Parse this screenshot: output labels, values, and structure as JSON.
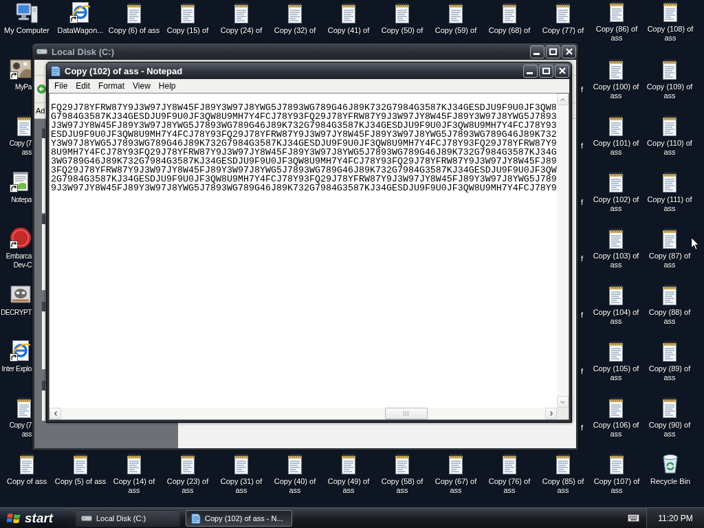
{
  "desktop": {
    "top_row": [
      {
        "label": "My Computer",
        "kind": "computer",
        "shortcut": false
      },
      {
        "label": "DataWagon...",
        "kind": "browser",
        "shortcut": true
      },
      {
        "label": "Copy (6) of ass",
        "kind": "text",
        "shortcut": false
      },
      {
        "label": "Copy (15) of",
        "kind": "text",
        "shortcut": false
      },
      {
        "label": "Copy (24) of",
        "kind": "text",
        "shortcut": false
      },
      {
        "label": "Copy (32) of",
        "kind": "text",
        "shortcut": false
      },
      {
        "label": "Copy (41) of",
        "kind": "text",
        "shortcut": false
      },
      {
        "label": "Copy (50) of",
        "kind": "text",
        "shortcut": false
      },
      {
        "label": "Copy (59) of",
        "kind": "text",
        "shortcut": false
      },
      {
        "label": "Copy (68) of",
        "kind": "text",
        "shortcut": false
      },
      {
        "label": "Copy (77) of",
        "kind": "text",
        "shortcut": false
      },
      {
        "label": "Copy (86) of ass",
        "kind": "text",
        "shortcut": false
      },
      {
        "label": "Copy (108) of ass",
        "kind": "text",
        "shortcut": false
      }
    ],
    "left_column": [
      {
        "label": "MyPa",
        "kind": "photo",
        "shortcut": true
      },
      {
        "label": "Copy (7 ass",
        "kind": "text",
        "shortcut": false
      },
      {
        "label": "Notepa",
        "kind": "editor",
        "shortcut": true
      },
      {
        "label": "Embarca Dev-C",
        "kind": "devcpp",
        "shortcut": true
      },
      {
        "label": "DECRYPT",
        "kind": "decrypt",
        "shortcut": false
      },
      {
        "label": "Inter Explo",
        "kind": "browser",
        "shortcut": true
      },
      {
        "label": "Copy (7 ass",
        "kind": "text",
        "shortcut": false
      }
    ],
    "cut_labels": [
      "f",
      "f",
      "f",
      "f",
      "f",
      "f",
      "f"
    ],
    "right_grid": [
      [
        {
          "label": "Copy (100) of ass",
          "kind": "text"
        },
        {
          "label": "Copy (109) of ass",
          "kind": "text"
        }
      ],
      [
        {
          "label": "Copy (101) of ass",
          "kind": "text"
        },
        {
          "label": "Copy (110) of ass",
          "kind": "text"
        }
      ],
      [
        {
          "label": "Copy (102) of ass",
          "kind": "text"
        },
        {
          "label": "Copy (111) of ass",
          "kind": "text"
        }
      ],
      [
        {
          "label": "Copy (103) of ass",
          "kind": "text"
        },
        {
          "label": "Copy (87) of ass",
          "kind": "text"
        }
      ],
      [
        {
          "label": "Copy (104) of ass",
          "kind": "text"
        },
        {
          "label": "Copy (88) of ass",
          "kind": "text"
        }
      ],
      [
        {
          "label": "Copy (105) of ass",
          "kind": "text"
        },
        {
          "label": "Copy (89) of ass",
          "kind": "text"
        }
      ],
      [
        {
          "label": "Copy (106) of ass",
          "kind": "text"
        },
        {
          "label": "Copy (90) of ass",
          "kind": "text"
        }
      ]
    ],
    "bottom_row": [
      {
        "label": "Copy of ass",
        "kind": "text"
      },
      {
        "label": "Copy (5) of ass",
        "kind": "text"
      },
      {
        "label": "Copy (14) of ass",
        "kind": "text"
      },
      {
        "label": "Copy (23) of ass",
        "kind": "text"
      },
      {
        "label": "Copy (31) of ass",
        "kind": "text"
      },
      {
        "label": "Copy (40) of ass",
        "kind": "text"
      },
      {
        "label": "Copy (49) of ass",
        "kind": "text"
      },
      {
        "label": "Copy (58) of ass",
        "kind": "text"
      },
      {
        "label": "Copy (67) of ass",
        "kind": "text"
      },
      {
        "label": "Copy (76) of ass",
        "kind": "text"
      },
      {
        "label": "Copy (85) of ass",
        "kind": "text"
      },
      {
        "label": "Copy (107) of ass",
        "kind": "text"
      },
      {
        "label": "Recycle Bin",
        "kind": "recycle"
      }
    ]
  },
  "explorer_window": {
    "title": "Local Disk (C:)",
    "active": false,
    "address_label": "Ad"
  },
  "notepad_window": {
    "title": "Copy (102) of ass - Notepad",
    "active": true,
    "menu": [
      "File",
      "Edit",
      "Format",
      "View",
      "Help"
    ],
    "lines": [
      "FQ29J78YFRW87Y9J3W97JY8W45FJ89Y3W97J8YWG5J7893WG789G46J89K732G7984G3587KJ34GESDJU9F9U0JF3QW8",
      "G7984G3587KJ34GESDJU9F9U0JF3QW8U9MH7Y4FCJ78Y93FQ29J78YFRW87Y9J3W97JY8W45FJ89Y3W97J8YWG5J7893",
      "J3W97JY8W45FJ89Y3W97J8YWG5J7893WG789G46J89K732G7984G3587KJ34GESDJU9F9U0JF3QW8U9MH7Y4FCJ78Y93",
      "ESDJU9F9U0JF3QW8U9MH7Y4FCJ78Y93FQ29J78YFRW87Y9J3W97JY8W45FJ89Y3W97J8YWG5J7893WG789G46J89K732",
      "Y3W97J8YWG5J7893WG789G46J89K732G7984G3587KJ34GESDJU9F9U0JF3QW8U9MH7Y4FCJ78Y93FQ29J78YFRW87Y9",
      "8U9MH7Y4FCJ78Y93FQ29J78YFRW87Y9J3W97JY8W45FJ89Y3W97J8YWG5J7893WG789G46J89K732G7984G3587KJ34G",
      "3WG789G46J89K732G7984G3587KJ34GESDJU9F9U0JF3QW8U9MH7Y4FCJ78Y93FQ29J78YFRW87Y9J3W97JY8W45FJ89",
      "3FQ29J78YFRW87Y9J3W97JY8W45FJ89Y3W97J8YWG5J7893WG789G46J89K732G7984G3587KJ34GESDJU9F9U0JF3QW",
      "2G7984G3587KJ34GESDJU9F9U0JF3QW8U9MH7Y4FCJ78Y93FQ29J78YFRW87Y9J3W97JY8W45FJ89Y3W97J8YWG5J789",
      "9J3W97JY8W45FJ89Y3W97J8YWG5J7893WG789G46J89K732G7984G3587KJ34GESDJU9F9U0JF3QW8U9MH7Y4FCJ78Y9"
    ]
  },
  "taskbar": {
    "start": "start",
    "tasks": [
      {
        "label": "Local Disk (C:)",
        "kind": "drive",
        "selected": false
      },
      {
        "label": "Copy (102) of ass - N...",
        "kind": "notepad",
        "selected": true
      }
    ],
    "clock": "11:20 PM"
  }
}
